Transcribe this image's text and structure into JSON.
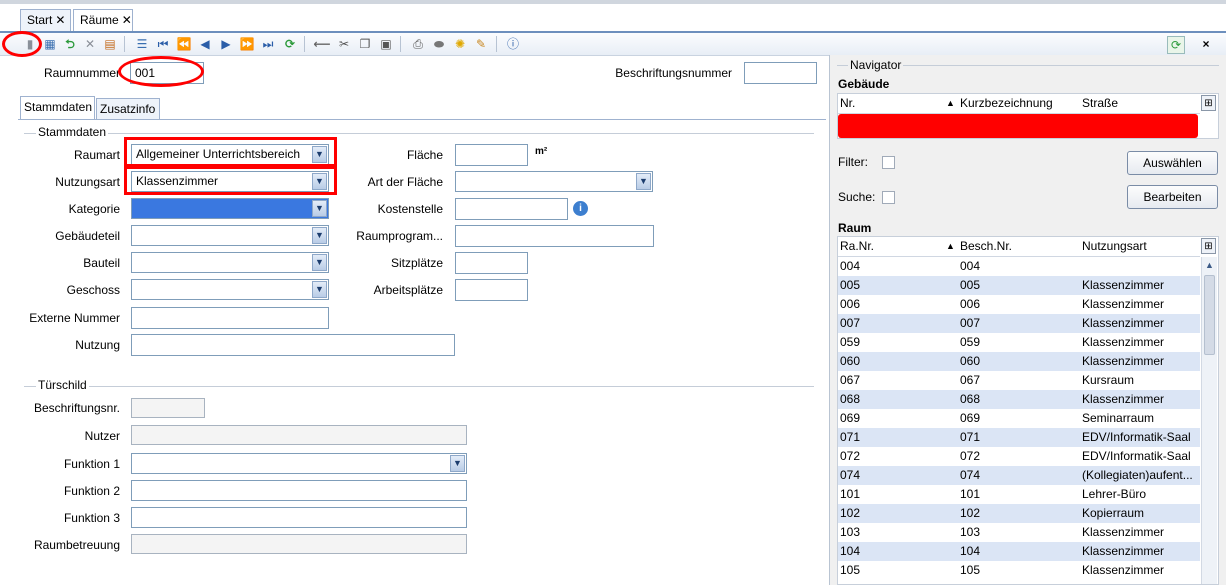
{
  "tabs": [
    {
      "label": "Start"
    },
    {
      "label": "Räume"
    }
  ],
  "toolbar": {
    "icons": [
      "new-icon",
      "save-icon",
      "undo-icon",
      "delete-icon",
      "properties-icon",
      "list-icon",
      "first-icon",
      "prev-page-icon",
      "prev-icon",
      "next-icon",
      "next-page-icon",
      "last-icon",
      "refresh-icon",
      "back-arrow-icon",
      "cut-icon",
      "copy-icon",
      "paste-icon",
      "print-icon",
      "preview-icon",
      "bulb-icon",
      "brush-icon",
      "help-icon"
    ],
    "right_icon": "refresh-green-icon",
    "close": "×"
  },
  "header": {
    "raumnummer_label": "Raumnummer",
    "raumnummer_value": "001",
    "beschriftungsnummer_label": "Beschriftungsnummer",
    "beschriftungsnummer_value": ""
  },
  "subtabs": [
    {
      "label": "Stammdaten"
    },
    {
      "label": "Zusatzinfo"
    }
  ],
  "stammdaten": {
    "title": "Stammdaten",
    "raumart_label": "Raumart",
    "raumart_value": "Allgemeiner Unterrichtsbereich",
    "nutzungsart_label": "Nutzungsart",
    "nutzungsart_value": "Klassenzimmer",
    "kategorie_label": "Kategorie",
    "kategorie_value": "",
    "gebaeudeteil_label": "Gebäudeteil",
    "bauteil_label": "Bauteil",
    "geschoss_label": "Geschoss",
    "externe_nummer_label": "Externe Nummer",
    "nutzung_label": "Nutzung",
    "flaeche_label": "Fläche",
    "flaeche_unit": "m²",
    "art_der_flaeche_label": "Art der Fläche",
    "kostenstelle_label": "Kostenstelle",
    "raumprogramm_label": "Raumprogram...",
    "sitzplaetze_label": "Sitzplätze",
    "arbeitsplaetze_label": "Arbeitsplätze"
  },
  "tuerschild": {
    "title": "Türschild",
    "beschriftungsnr_label": "Beschriftungsnr.",
    "nutzer_label": "Nutzer",
    "funktion1_label": "Funktion 1",
    "funktion2_label": "Funktion 2",
    "funktion3_label": "Funktion 3",
    "raumbetreuung_label": "Raumbetreuung"
  },
  "navigator": {
    "title": "Navigator",
    "gebaeude_title": "Gebäude",
    "gebaeude_columns": [
      "Nr.",
      "Kurzbezeichnung",
      "Straße"
    ],
    "filter_label": "Filter:",
    "suche_label": "Suche:",
    "auswaehlen_label": "Auswählen",
    "bearbeiten_label": "Bearbeiten",
    "raum_title": "Raum",
    "raum_columns": [
      "Ra.Nr.",
      "Besch.Nr.",
      "Nutzungsart"
    ],
    "rows": [
      {
        "nr": "004",
        "besch": "004",
        "art": ""
      },
      {
        "nr": "005",
        "besch": "005",
        "art": "Klassenzimmer"
      },
      {
        "nr": "006",
        "besch": "006",
        "art": "Klassenzimmer"
      },
      {
        "nr": "007",
        "besch": "007",
        "art": "Klassenzimmer"
      },
      {
        "nr": "059",
        "besch": "059",
        "art": "Klassenzimmer"
      },
      {
        "nr": "060",
        "besch": "060",
        "art": "Klassenzimmer"
      },
      {
        "nr": "067",
        "besch": "067",
        "art": "Kursraum"
      },
      {
        "nr": "068",
        "besch": "068",
        "art": "Klassenzimmer"
      },
      {
        "nr": "069",
        "besch": "069",
        "art": "Seminarraum"
      },
      {
        "nr": "071",
        "besch": "071",
        "art": "EDV/Informatik-Saal"
      },
      {
        "nr": "072",
        "besch": "072",
        "art": "EDV/Informatik-Saal"
      },
      {
        "nr": "074",
        "besch": "074",
        "art": "(Kollegiaten)aufent..."
      },
      {
        "nr": "101",
        "besch": "101",
        "art": "Lehrer-Büro"
      },
      {
        "nr": "102",
        "besch": "102",
        "art": "Kopierraum"
      },
      {
        "nr": "103",
        "besch": "103",
        "art": "Klassenzimmer"
      },
      {
        "nr": "104",
        "besch": "104",
        "art": "Klassenzimmer"
      },
      {
        "nr": "105",
        "besch": "105",
        "art": "Klassenzimmer"
      }
    ]
  },
  "colors": {
    "highlight": "#ff0000",
    "row_alt": "#dbe5f5",
    "selected_field": "#3a78e0"
  }
}
